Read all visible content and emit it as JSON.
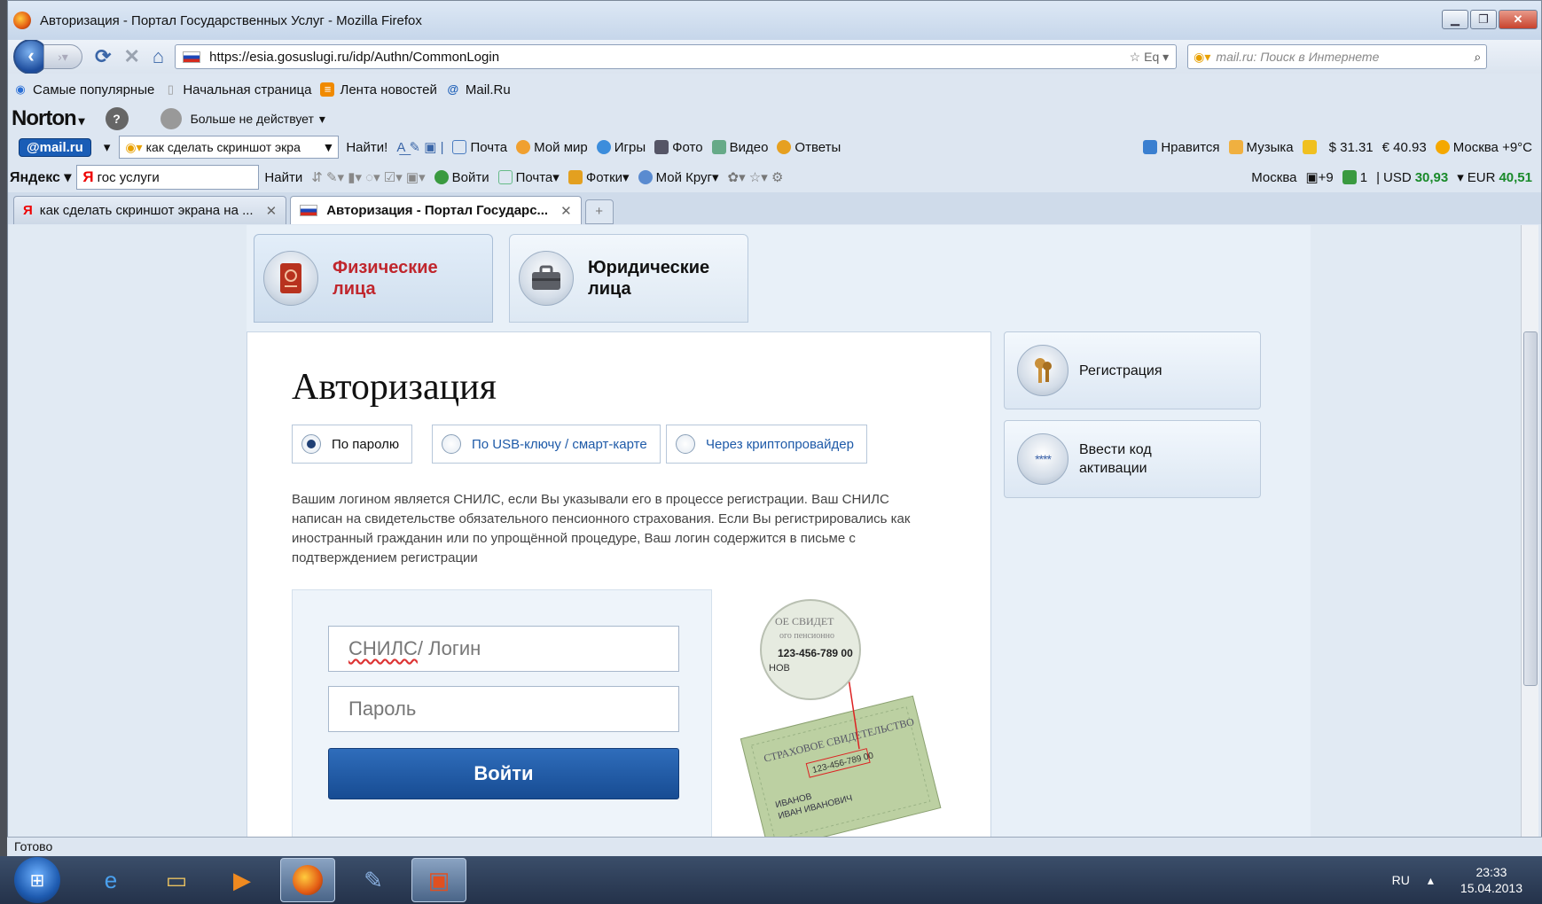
{
  "window": {
    "title": "Авторизация - Портал Государственных Услуг - Mozilla Firefox",
    "url": "https://esia.gosuslugi.ru/idp/Authn/CommonLogin",
    "url_tail": "Eq",
    "search_placeholder": "mail.ru: Поиск в Интернете"
  },
  "bookmarks": [
    "Самые популярные",
    "Начальная страница",
    "Лента новостей",
    "Mail.Ru"
  ],
  "norton": {
    "brand": "Norton",
    "status": "Больше не действует"
  },
  "mailbar": {
    "brand": "@mail.ru",
    "query": "как сделать скриншот экра",
    "find": "Найти!",
    "items": [
      "Почта",
      "Мой мир",
      "Игры",
      "Фото",
      "Видео",
      "Ответы"
    ],
    "right": [
      "Нравится",
      "Музыка",
      "$ 31.31",
      "€ 40.93",
      "Москва +9°C"
    ]
  },
  "yandexbar": {
    "brand": "Яндекс",
    "query": "гос услуги",
    "find": "Найти",
    "items": [
      "Войти",
      "Почта",
      "Фотки",
      "Мой Круг"
    ],
    "city": "Москва",
    "temp": "+9",
    "mail_count": "1",
    "usd_label": "USD",
    "usd": "30,93",
    "eur_label": "EUR",
    "eur": "40,51"
  },
  "tabs": [
    {
      "label": "как сделать скриншот экрана на ...",
      "active": false
    },
    {
      "label": "Авторизация - Портал Государс...",
      "active": true
    }
  ],
  "page": {
    "user_tabs": [
      {
        "label": "Физические лица",
        "selected": true
      },
      {
        "label": "Юридические лица",
        "selected": false
      }
    ],
    "heading": "Авторизация",
    "methods": [
      "По паролю",
      "По USB-ключу / смарт-карте",
      "Через криптопровайдер"
    ],
    "info": "Вашим логином является СНИЛС, если Вы указывали его в процессе регистрации. Ваш СНИЛС написан на свидетельстве обязательного пенсионного страхования. Если Вы регистрировались как иностранный гражданин или по упрощённой процедуре, Ваш логин содержится в письме с подтверждением регистрации",
    "login_placeholder_a": "СНИЛС",
    "login_placeholder_b": " / Логин",
    "password_placeholder": "Пароль",
    "submit": "Войти",
    "snils_number": "123-456-789 00",
    "side": [
      "Регистрация",
      "Ввести код активации"
    ]
  },
  "status": "Готово",
  "taskbar": {
    "lang": "RU",
    "time": "23:33",
    "date": "15.04.2013"
  }
}
